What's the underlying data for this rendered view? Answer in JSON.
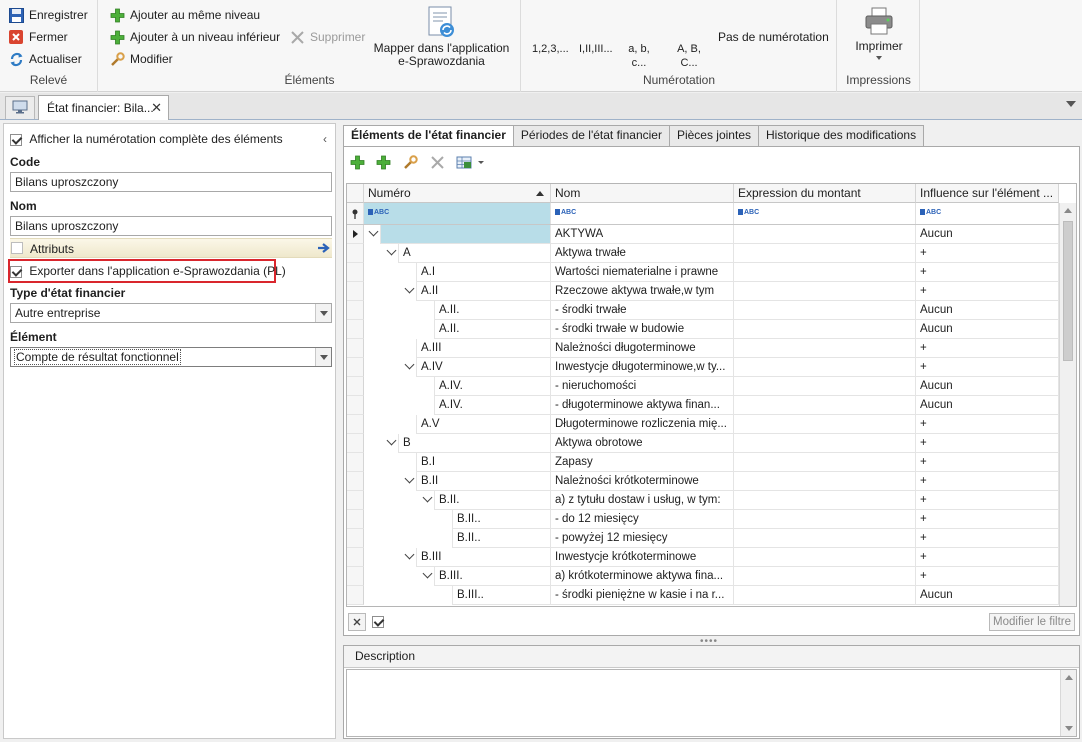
{
  "ribbon": {
    "releve": {
      "label": "Relevé",
      "save": "Enregistrer",
      "close": "Fermer",
      "refresh": "Actualiser"
    },
    "elements": {
      "label": "Éléments",
      "add_same": "Ajouter au même niveau",
      "add_lower": "Ajouter à un niveau inférieur",
      "delete": "Supprimer",
      "modify": "Modifier",
      "map_line1": "Mapper dans l'application",
      "map_line2": "e-Sprawozdania"
    },
    "numerotation": {
      "label": "Numérotation",
      "arabic": "1,2,3,...",
      "roman": "I,II,III...",
      "lower_line1": "a, b,",
      "lower_line2": "c...",
      "upper_line1": "A, B,",
      "upper_line2": "C...",
      "none": "Pas de numérotation"
    },
    "impressions": {
      "label": "Impressions",
      "print": "Imprimer"
    }
  },
  "doc_tab": {
    "title": "État financier: Bila..."
  },
  "left_panel": {
    "show_full_numbering": "Afficher la numérotation complète des éléments",
    "code_label": "Code",
    "code_value": "Bilans uproszczony",
    "name_label": "Nom",
    "name_value": "Bilans uproszczony",
    "attributes": "Attributs",
    "export_label": "Exporter dans l'application e-Sprawozdania (PL)",
    "type_label": "Type d'état financier",
    "type_value": "Autre entreprise",
    "element_label": "Élément",
    "element_value": "Compte de résultat fonctionnel"
  },
  "tabs": [
    "Éléments de l'état financier",
    "Périodes de l'état financier",
    "Pièces jointes",
    "Historique des modifications"
  ],
  "grid": {
    "columns": [
      "Numéro",
      "Nom",
      "Expression du montant",
      "Influence sur l'élément ..."
    ],
    "filter_token": "ABC",
    "rows": [
      {
        "num": "",
        "name": "AKTYWA",
        "expr": "",
        "infl": "Aucun",
        "level": 0,
        "expanded": true
      },
      {
        "num": "A",
        "name": "Aktywa trwałe",
        "expr": "",
        "infl": "+",
        "level": 1,
        "expanded": true
      },
      {
        "num": "A.I",
        "name": "Wartości niematerialne i prawne",
        "expr": "",
        "infl": "+",
        "level": 2,
        "expanded": false
      },
      {
        "num": "A.II",
        "name": "Rzeczowe aktywa trwałe,w tym",
        "expr": "",
        "infl": "+",
        "level": 2,
        "expanded": true
      },
      {
        "num": "A.II.",
        "name": "- środki trwałe",
        "expr": "",
        "infl": "Aucun",
        "level": 3,
        "expanded": false
      },
      {
        "num": "A.II.",
        "name": "- środki trwałe w budowie",
        "expr": "",
        "infl": "Aucun",
        "level": 3,
        "expanded": false
      },
      {
        "num": "A.III",
        "name": "Należności długoterminowe",
        "expr": "",
        "infl": "+",
        "level": 2,
        "expanded": false
      },
      {
        "num": "A.IV",
        "name": "Inwestycje długoterminowe,w ty...",
        "expr": "",
        "infl": "+",
        "level": 2,
        "expanded": true
      },
      {
        "num": "A.IV.",
        "name": "- nieruchomości",
        "expr": "",
        "infl": "Aucun",
        "level": 3,
        "expanded": false
      },
      {
        "num": "A.IV.",
        "name": "- długoterminowe aktywa finan...",
        "expr": "",
        "infl": "Aucun",
        "level": 3,
        "expanded": false
      },
      {
        "num": "A.V",
        "name": "Długoterminowe rozliczenia mię...",
        "expr": "",
        "infl": "+",
        "level": 2,
        "expanded": false
      },
      {
        "num": "B",
        "name": "Aktywa obrotowe",
        "expr": "",
        "infl": "+",
        "level": 1,
        "expanded": true
      },
      {
        "num": "B.I",
        "name": "Zapasy",
        "expr": "",
        "infl": "+",
        "level": 2,
        "expanded": false
      },
      {
        "num": "B.II",
        "name": "Należności krótkoterminowe",
        "expr": "",
        "infl": "+",
        "level": 2,
        "expanded": true
      },
      {
        "num": "B.II.",
        "name": "a) z tytułu dostaw i usług, w tym:",
        "expr": "",
        "infl": "+",
        "level": 3,
        "expanded": true
      },
      {
        "num": "B.II..",
        "name": "- do 12 miesięcy",
        "expr": "",
        "infl": "+",
        "level": 4,
        "expanded": false
      },
      {
        "num": "B.II..",
        "name": "- powyżej 12 miesięcy",
        "expr": "",
        "infl": "+",
        "level": 4,
        "expanded": false
      },
      {
        "num": "B.III",
        "name": "Inwestycje krótkoterminowe",
        "expr": "",
        "infl": "+",
        "level": 2,
        "expanded": true
      },
      {
        "num": "B.III.",
        "name": "a) krótkoterminowe aktywa fina...",
        "expr": "",
        "infl": "+",
        "level": 3,
        "expanded": true
      },
      {
        "num": "B.III..",
        "name": "- środki pieniężne w kasie i na r...",
        "expr": "",
        "infl": "Aucun",
        "level": 4,
        "expanded": false
      }
    ]
  },
  "grid_footer": {
    "modify_filter": "Modifier le filtre"
  },
  "description": {
    "label": "Description"
  },
  "colors": {
    "accent_selected": "#b8dde8",
    "highlight_red": "#d9262d",
    "add_green": "#4caf3a"
  }
}
